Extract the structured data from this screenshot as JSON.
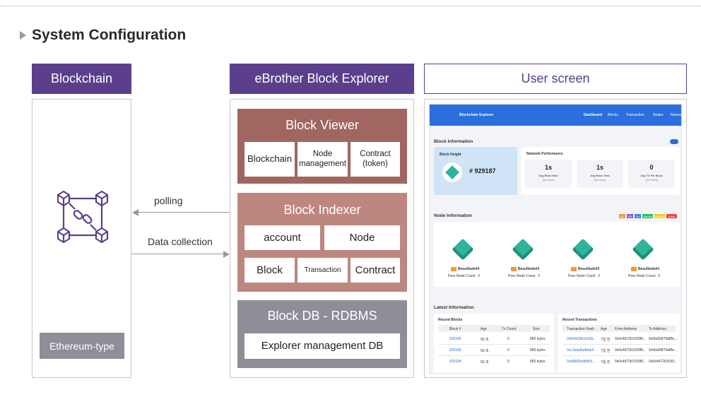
{
  "title": "System Configuration",
  "columns": {
    "blockchain": {
      "header": "Blockchain",
      "badge": "Ethereum-type",
      "icon": "blockchain-network-icon"
    },
    "explorer": {
      "header": "eBrother Block Explorer",
      "viewer": {
        "title": "Block Viewer",
        "cells": [
          "Blockchain",
          "Node management",
          "Contract (token)"
        ]
      },
      "indexer": {
        "title": "Block Indexer",
        "cells": [
          "account",
          "Node",
          "Block",
          "Transaction",
          "Contract"
        ]
      },
      "db": {
        "title": "Block DB - RDBMS",
        "cell": "Explorer management DB"
      }
    },
    "user": {
      "header": "User screen"
    }
  },
  "arrows": {
    "polling": "polling",
    "data_collection": "Data collection"
  },
  "screen": {
    "brand": "Blockchain Explorer",
    "nav": [
      "Dashboard",
      "Blocks",
      "Transaction",
      "Nodes",
      "Tokens"
    ],
    "block_info_title": "Block Information",
    "block_height_label": "Block Height",
    "block_height_value": "# 929187",
    "network_title": "Network Performance",
    "stats": [
      {
        "value": "1s",
        "label": "Avg Block New",
        "sub": "(24 Hour)"
      },
      {
        "value": "1s",
        "label": "Avg Block Time",
        "sub": "(24 Hour)"
      },
      {
        "value": "0",
        "label": "Avg TX Per Block",
        "sub": "(24 Hour)"
      }
    ],
    "node_info_title": "Node Information",
    "node_tags": [
      "LS",
      "PA",
      "PA",
      "Normal",
      "Warning",
      "Error"
    ],
    "node_tag_colors": [
      "#f29b38",
      "#8b5cf6",
      "#3b82f6",
      "#22c55e",
      "#facc15",
      "#ef4444"
    ],
    "nodes": [
      "BesuNode#4",
      "BesuNode#3",
      "BesuNode#2",
      "BesuNode#1"
    ],
    "peer_label": "Peer Node Count",
    "peer_count": "3",
    "latest_title": "Latest Information",
    "recent_blocks_title": "Recent Blocks",
    "recent_blocks_cols": [
      "Block #",
      "Age",
      "Tx Count",
      "Size"
    ],
    "recent_blocks_rows": [
      [
        "929186",
        "59 초",
        "0",
        "865 bytes"
      ],
      [
        "929185",
        "59 초",
        "0",
        "865 bytes"
      ],
      [
        "929184",
        "59 초",
        "0",
        "865 bytes"
      ]
    ],
    "recent_tx_title": "Recent Transactions",
    "recent_tx_cols": [
      "Transaction Hash",
      "Age",
      "From Address",
      "To Address"
    ],
    "recent_tx_rows": [
      [
        "0xfb4d29b1e03b...",
        "7일 전",
        "0x0e4672b1f1f3f6...",
        "0x0bd39f79d8fe..."
      ],
      [
        "0xc1bda8a4b6e6...",
        "7일 전",
        "0x0e4672b1f1f3f6...",
        "0x0bd39f79d8fe..."
      ],
      [
        "0xaf8d2be8fd0d...",
        "7일 전",
        "0x0e4672b1f1f3f6...",
        "0x0e4672b1f1f3..."
      ]
    ]
  }
}
